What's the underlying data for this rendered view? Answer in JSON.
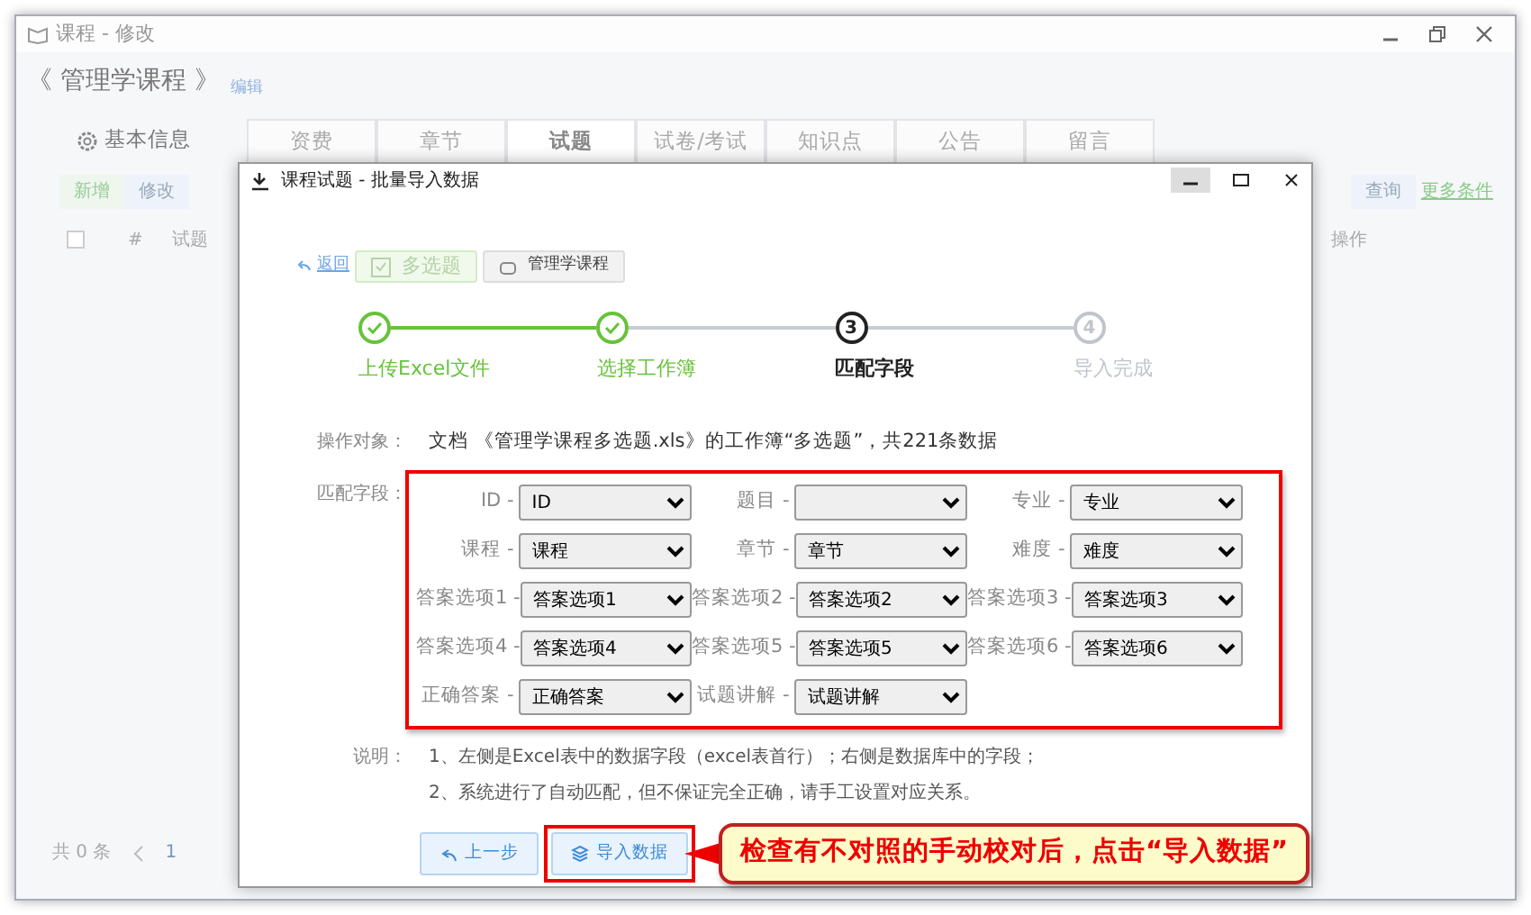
{
  "window": {
    "title": "课程 - 修改"
  },
  "course": {
    "title": "《 管理学课程 》",
    "edit_link": "编辑"
  },
  "sidebar": {
    "items": [
      {
        "label": "基本信息"
      }
    ]
  },
  "tabs": [
    {
      "label": "资费",
      "selected": false
    },
    {
      "label": "章节",
      "selected": false
    },
    {
      "label": "试题",
      "selected": true
    },
    {
      "label": "试卷/考试",
      "selected": false
    },
    {
      "label": "知识点",
      "selected": false
    },
    {
      "label": "公告",
      "selected": false
    },
    {
      "label": "留言",
      "selected": false
    }
  ],
  "toolbar": {
    "buttons": [
      {
        "label": "新增",
        "kind": "add"
      },
      {
        "label": "修改",
        "kind": "edit"
      }
    ],
    "search_button": "查询",
    "more_filters": "更多条件"
  },
  "table": {
    "select_all_checked": false,
    "columns": [
      {
        "label": "#"
      },
      {
        "label": "试题"
      },
      {
        "label": "操作"
      }
    ]
  },
  "pagination": {
    "total": "共 0 条",
    "page": "1"
  },
  "dialog": {
    "title": "课程试题 - 批量导入数据",
    "back": "返回",
    "tags": [
      {
        "label": "多选题",
        "kind": "type"
      },
      {
        "label": "管理学课程",
        "kind": "course"
      }
    ],
    "steps": [
      {
        "label": "上传Excel文件",
        "completed": true,
        "current": false
      },
      {
        "label": "选择工作簿",
        "completed": true,
        "current": false
      },
      {
        "label": "匹配字段",
        "completed": false,
        "current": true,
        "number": "3"
      },
      {
        "label": "导入完成",
        "completed": false,
        "current": false,
        "number": "4"
      }
    ],
    "operation": {
      "label": "操作对象：",
      "text": "文档 《管理学课程多选题.xls》的工作簿“多选题”，共221条数据"
    },
    "mapping": {
      "label": "匹配字段：",
      "fields": [
        {
          "label": "ID -",
          "value": "ID"
        },
        {
          "label": "题目 -"
        },
        {
          "label": "专业 -",
          "value": "专业"
        },
        {
          "label": "课程 -",
          "value": "课程"
        },
        {
          "label": "章节 -",
          "value": "章节"
        },
        {
          "label": "难度 -",
          "value": "难度"
        },
        {
          "label": "答案选项1 -",
          "value": "答案选项1"
        },
        {
          "label": "答案选项2 -",
          "value": "答案选项2"
        },
        {
          "label": "答案选项3 -",
          "value": "答案选项3"
        },
        {
          "label": "答案选项4 -",
          "value": "答案选项4"
        },
        {
          "label": "答案选项5 -",
          "value": "答案选项5"
        },
        {
          "label": "答案选项6 -",
          "value": "答案选项6"
        },
        {
          "label": "正确答案 -",
          "value": "正确答案"
        },
        {
          "label": "试题讲解 -",
          "value": "试题讲解"
        }
      ]
    },
    "notes": {
      "label": "说明：",
      "lines": [
        "1、左侧是Excel表中的数据字段（excel表首行）；右侧是数据库中的字段；",
        "2、系统进行了自动匹配，但不保证完全正确，请手工设置对应关系。"
      ]
    },
    "buttons": [
      {
        "label": "上一步",
        "kind": "prev"
      },
      {
        "label": "导入数据",
        "kind": "import"
      }
    ]
  },
  "callout": {
    "text": "检查有不对照的手动校对后，点击“导入数据”"
  }
}
